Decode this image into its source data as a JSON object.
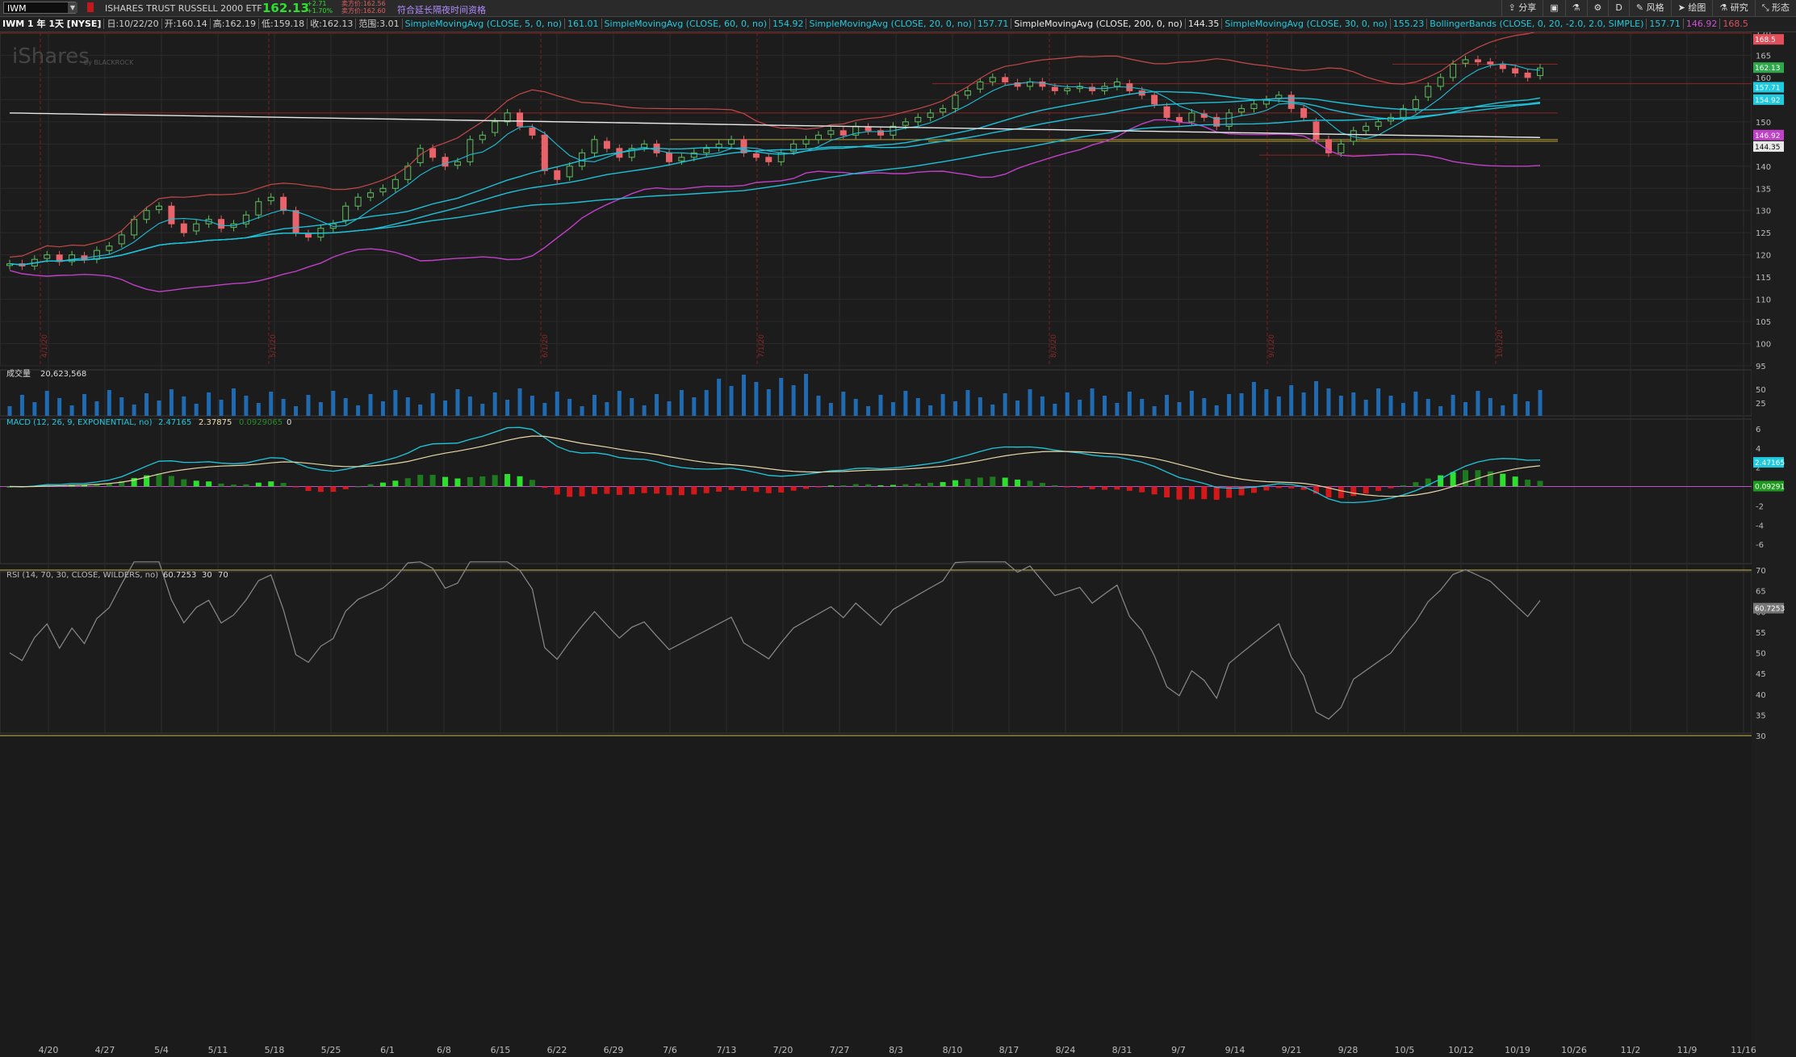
{
  "toolbar": {
    "symbol": "IWM",
    "security_name": "ISHARES TRUST RUSSELL 2000 ETF",
    "last_price": "162.13",
    "change": "+2.71",
    "change_pct": "+1.70%",
    "bid": "卖方价:162.56",
    "ask": "卖方价:162.60",
    "notice": "符合延长隔夜时间资格",
    "tools": [
      "分享",
      "风格",
      "绘图",
      "研究",
      "形态"
    ],
    "period": "D"
  },
  "studybar": {
    "title": "IWM 1 年 1天 [NYSE]",
    "date": "日:10/22/20",
    "open": "开:160.14",
    "high": "高:162.19",
    "low": "低:159.18",
    "close": "收:162.13",
    "range": "范围:3.01",
    "sma5": "SimpleMovingAvg (CLOSE, 5, 0, no)",
    "sma5_v": "161.01",
    "sma60": "SimpleMovingAvg (CLOSE, 60, 0, no)",
    "sma60_v": "154.92",
    "sma20": "SimpleMovingAvg (CLOSE, 20, 0, no)",
    "sma20_v": "157.71",
    "sma200": "SimpleMovingAvg (CLOSE, 200, 0, no)",
    "sma200_v": "144.35",
    "sma30": "SimpleMovingAvg (CLOSE, 30, 0, no)",
    "sma30_v": "155.23",
    "bb": "BollingerBands (CLOSE, 0, 20, -2.0, 2.0, SIMPLE)",
    "bb_v1": "157.71",
    "bb_v2": "146.92",
    "bb_v3": "168.5"
  },
  "watermark": {
    "brand": "iShares",
    "by": "by BLACKROCK"
  },
  "price_axis": {
    "ticks": [
      "170",
      "165",
      "160",
      "155",
      "150",
      "145",
      "140",
      "135",
      "130",
      "125",
      "120",
      "115",
      "110",
      "105",
      "100",
      "95"
    ],
    "flags": [
      {
        "text": "168.5",
        "color": "#e0505a"
      },
      {
        "text": "162.13",
        "color": "#2ea84a"
      },
      {
        "text": "157.71",
        "color": "#1ecbe0"
      },
      {
        "text": "154.92",
        "color": "#1ecbe0"
      },
      {
        "text": "146.92",
        "color": "#c040c8"
      },
      {
        "text": "144.35",
        "color": "#e8e8e8"
      }
    ]
  },
  "month_markers": [
    "4/1/20",
    "5/1/20",
    "6/1/20",
    "7/1/20",
    "8/3/20",
    "9/1/20",
    "10/1/20"
  ],
  "volume_panel": {
    "label": "成交量",
    "value": "20,623,568",
    "ticks": [
      "50",
      "25"
    ]
  },
  "macd_panel": {
    "label": "MACD (12, 26, 9, EXPONENTIAL, no)",
    "v1": "2.47165",
    "v2": "2.37875",
    "v3": "0.0929065",
    "v4": "0",
    "ticks": [
      "6",
      "4",
      "2",
      "0",
      "-2",
      "-4",
      "-6"
    ],
    "flag1": "2.47165",
    "flag2": "0.09291"
  },
  "rsi_panel": {
    "label": "RSI (14, 70, 30, CLOSE, WILDERS, no)",
    "value": "60.7253",
    "v30": "30",
    "v70": "70",
    "ticks": [
      "70",
      "65",
      "60",
      "55",
      "50",
      "45",
      "40",
      "35",
      "30"
    ],
    "flag": "60.7253"
  },
  "x_axis": {
    "dates": [
      "4/20",
      "4/27",
      "5/4",
      "5/11",
      "5/18",
      "5/25",
      "6/1",
      "6/8",
      "6/15",
      "6/22",
      "6/29",
      "7/6",
      "7/13",
      "7/20",
      "7/27",
      "8/3",
      "8/10",
      "8/17",
      "8/24",
      "8/31",
      "9/7",
      "9/14",
      "9/21",
      "9/28",
      "10/5",
      "10/12",
      "10/19",
      "10/26",
      "11/2",
      "11/9",
      "11/16"
    ]
  },
  "chart_data": {
    "type": "candlestick",
    "symbol": "IWM",
    "price_range": [
      95,
      170
    ],
    "candles_close": [
      118,
      117.5,
      119,
      120,
      118.5,
      120,
      119,
      121,
      122,
      124.5,
      128,
      130,
      131,
      127,
      125,
      127,
      128,
      126,
      127,
      129,
      132,
      133,
      130,
      125,
      124,
      126,
      127,
      131,
      133,
      134,
      135,
      137,
      140,
      144,
      142,
      140,
      141,
      146,
      147,
      150,
      152,
      149,
      147,
      139,
      137,
      140,
      143,
      146,
      144,
      142,
      144,
      145,
      143,
      141,
      142,
      143,
      144,
      145,
      146,
      143,
      142,
      141,
      143,
      145,
      146,
      147,
      148,
      147,
      149,
      148,
      147,
      149,
      150,
      151,
      152,
      153,
      156,
      157,
      159,
      160,
      159,
      158,
      159,
      158,
      157,
      157.5,
      158,
      157,
      158,
      159,
      157,
      156,
      154,
      151,
      150,
      152,
      151,
      149,
      152,
      153,
      154,
      155,
      156,
      153,
      151,
      146,
      143,
      145,
      148,
      149,
      150,
      151,
      153,
      155,
      158,
      160,
      163,
      164,
      163.5,
      163,
      162,
      161,
      160,
      162.13
    ]
  }
}
